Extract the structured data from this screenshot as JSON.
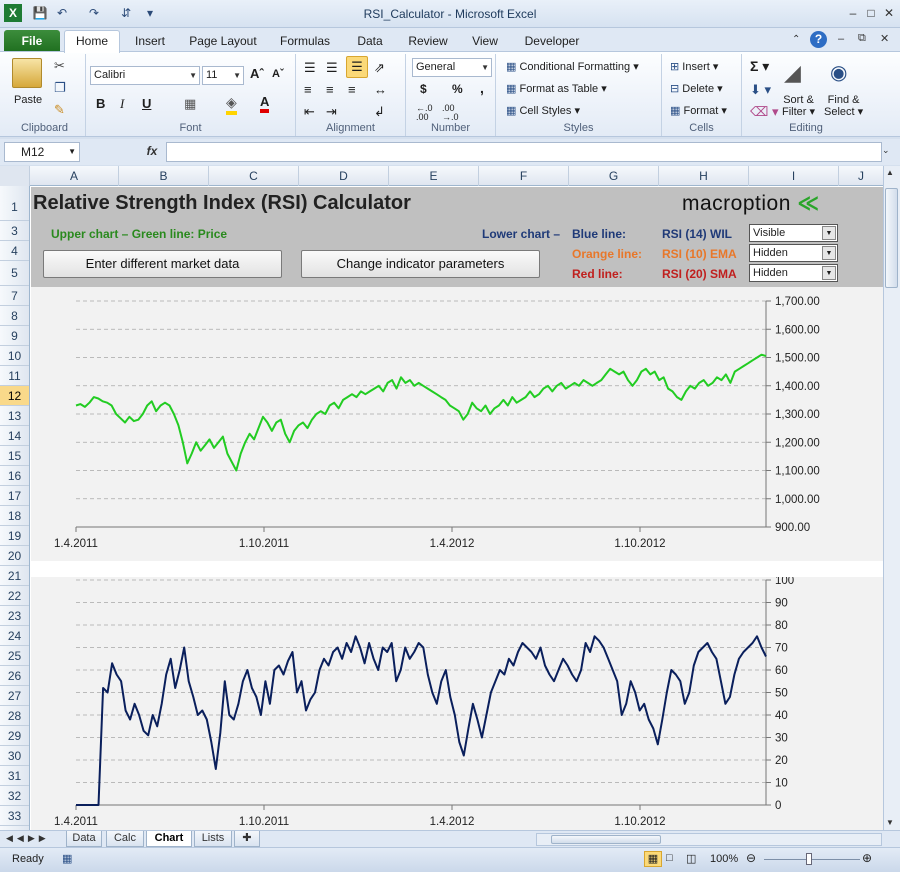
{
  "window": {
    "title": "RSI_Calculator  -  Microsoft Excel"
  },
  "tabs": [
    {
      "label": "File"
    },
    {
      "label": "Home"
    },
    {
      "label": "Insert"
    },
    {
      "label": "Page Layout"
    },
    {
      "label": "Formulas"
    },
    {
      "label": "Data"
    },
    {
      "label": "Review"
    },
    {
      "label": "View"
    },
    {
      "label": "Developer"
    }
  ],
  "ribbon": {
    "clipboard": {
      "label": "Clipboard",
      "paste": "Paste"
    },
    "font": {
      "label": "Font",
      "name": "Calibri",
      "size": "11"
    },
    "alignment": {
      "label": "Alignment"
    },
    "number": {
      "label": "Number",
      "format": "General",
      "currency": "$",
      "percent": "%",
      "comma": ","
    },
    "styles": {
      "label": "Styles",
      "cond": "Conditional Formatting",
      "table": "Format as Table",
      "cell": "Cell Styles"
    },
    "cells": {
      "label": "Cells",
      "insert": "Insert",
      "delete": "Delete",
      "format": "Format"
    },
    "editing": {
      "label": "Editing",
      "sort1": "Sort &",
      "sort2": "Filter",
      "find1": "Find &",
      "find2": "Select"
    }
  },
  "formula_bar": {
    "name_box": "M12",
    "fx": "fx",
    "formula": ""
  },
  "columns": [
    "A",
    "B",
    "C",
    "D",
    "E",
    "F",
    "G",
    "H",
    "I",
    "J"
  ],
  "rows": [
    "1",
    "3",
    "4",
    "5",
    "7",
    "8",
    "9",
    "10",
    "11",
    "12",
    "13",
    "14",
    "15",
    "16",
    "17",
    "18",
    "19",
    "20",
    "21",
    "22",
    "23",
    "24",
    "25",
    "26",
    "27",
    "28",
    "29",
    "30",
    "31",
    "32",
    "33"
  ],
  "sheet": {
    "title": "Relative Strength Index (RSI) Calculator",
    "brand": "macroption",
    "upper_label": "Upper chart – Green line: Price",
    "lower_label": "Lower chart –",
    "blue_line": "Blue line:",
    "orange_line": "Orange line:",
    "red_line": "Red line:",
    "rsi_blue": "RSI (14) WIL",
    "rsi_orange": "RSI (10) EMA",
    "rsi_red": "RSI (20) SMA",
    "sel_blue": "Visible",
    "sel_orange": "Hidden",
    "sel_red": "Hidden",
    "btn_data": "Enter different market data",
    "btn_params": "Change indicator parameters"
  },
  "colors": {
    "price": "#22cc22",
    "rsi": "#0a1f5c",
    "orange": "#e8772a",
    "red": "#c0201e",
    "navy": "#1f3a78",
    "green_text": "#2a8a1e"
  },
  "chart_data": [
    {
      "type": "line",
      "x_ticks": [
        "1.4.2011",
        "1.10.2011",
        "1.4.2012",
        "1.10.2012"
      ],
      "y_ticks": [
        "1,700.00",
        "1,600.00",
        "1,500.00",
        "1,400.00",
        "1,300.00",
        "1,200.00",
        "1,100.00",
        "1,000.00",
        "900.00"
      ],
      "ylim": [
        900,
        1700
      ],
      "series": [
        {
          "values": [
            1330,
            1335,
            1325,
            1340,
            1360,
            1355,
            1345,
            1340,
            1330,
            1300,
            1285,
            1270,
            1290,
            1275,
            1280,
            1300,
            1330,
            1345,
            1310,
            1330,
            1340,
            1330,
            1300,
            1260,
            1200,
            1125,
            1160,
            1200,
            1170,
            1190,
            1210,
            1180,
            1200,
            1220,
            1160,
            1130,
            1100,
            1160,
            1200,
            1230,
            1210,
            1250,
            1290,
            1270,
            1240,
            1270,
            1280,
            1230,
            1200,
            1240,
            1260,
            1270,
            1250,
            1280,
            1300,
            1310,
            1300,
            1330,
            1340,
            1320,
            1350,
            1360,
            1370,
            1360,
            1380,
            1370,
            1380,
            1390,
            1400,
            1380,
            1410,
            1420,
            1390,
            1430,
            1410,
            1420,
            1400,
            1410,
            1400,
            1390,
            1380,
            1370,
            1360,
            1350,
            1330,
            1320,
            1310,
            1280,
            1300,
            1340,
            1320,
            1310,
            1330,
            1300,
            1320,
            1330,
            1350,
            1330,
            1360,
            1340,
            1350,
            1360,
            1380,
            1360,
            1370,
            1390,
            1400,
            1380,
            1400,
            1410,
            1390,
            1400,
            1410,
            1400,
            1420,
            1410,
            1400,
            1410,
            1420,
            1440,
            1460,
            1450,
            1440,
            1450,
            1420,
            1400,
            1420,
            1450,
            1460,
            1440,
            1450,
            1420,
            1430,
            1390,
            1380,
            1360,
            1350,
            1380,
            1400,
            1390,
            1410,
            1420,
            1400,
            1410,
            1430,
            1420,
            1440,
            1410,
            1450,
            1460,
            1470,
            1480,
            1490,
            1500,
            1510,
            1505
          ]
        }
      ]
    },
    {
      "type": "line",
      "x_ticks": [
        "1.4.2011",
        "1.10.2011",
        "1.4.2012",
        "1.10.2012"
      ],
      "y_ticks": [
        "100",
        "90",
        "80",
        "70",
        "60",
        "50",
        "40",
        "30",
        "20",
        "10",
        "0"
      ],
      "ylim": [
        0,
        100
      ],
      "series": [
        {
          "values": [
            0,
            0,
            0,
            0,
            0,
            0,
            52,
            50,
            63,
            58,
            55,
            42,
            38,
            45,
            40,
            33,
            31,
            40,
            35,
            45,
            58,
            65,
            52,
            60,
            70,
            55,
            48,
            40,
            42,
            38,
            28,
            16,
            32,
            55,
            40,
            38,
            45,
            55,
            60,
            52,
            48,
            40,
            55,
            45,
            60,
            62,
            58,
            64,
            68,
            50,
            55,
            42,
            47,
            50,
            60,
            65,
            62,
            68,
            70,
            65,
            72,
            68,
            75,
            70,
            63,
            72,
            65,
            60,
            70,
            68,
            72,
            55,
            60,
            70,
            65,
            68,
            72,
            70,
            58,
            50,
            45,
            55,
            60,
            48,
            40,
            28,
            22,
            34,
            45,
            38,
            30,
            40,
            50,
            55,
            60,
            58,
            65,
            62,
            68,
            72,
            70,
            68,
            65,
            70,
            62,
            58,
            55,
            60,
            65,
            62,
            58,
            55,
            60,
            72,
            68,
            75,
            73,
            70,
            65,
            60,
            55,
            40,
            45,
            55,
            50,
            42,
            45,
            38,
            34,
            27,
            38,
            50,
            60,
            58,
            55,
            45,
            50,
            62,
            68,
            70,
            72,
            68,
            65,
            55,
            45,
            48,
            58,
            65,
            68,
            70,
            72,
            75,
            70,
            66
          ]
        }
      ]
    }
  ]
}
